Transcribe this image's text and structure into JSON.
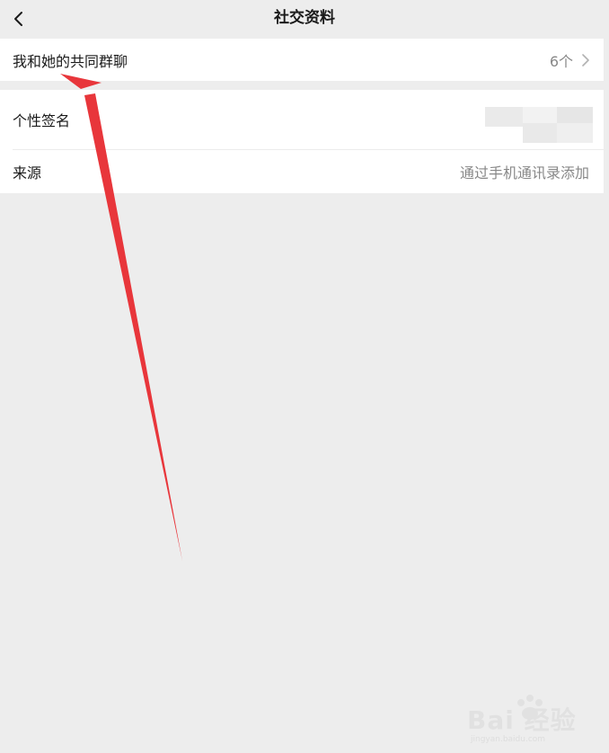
{
  "nav": {
    "title": "社交资料",
    "back_icon": "chevron-left-icon"
  },
  "groups_row": {
    "label": "我和她的共同群聊",
    "count": "6个",
    "chevron_icon": "chevron-right-icon"
  },
  "signature_row": {
    "label": "个性签名"
  },
  "source_row": {
    "label": "来源",
    "value": "通过手机通讯录添加"
  },
  "annotation": {
    "color": "#e8363b"
  },
  "watermark": {
    "text": "Bai 经验",
    "sub": "jingyan.baidu.com"
  }
}
